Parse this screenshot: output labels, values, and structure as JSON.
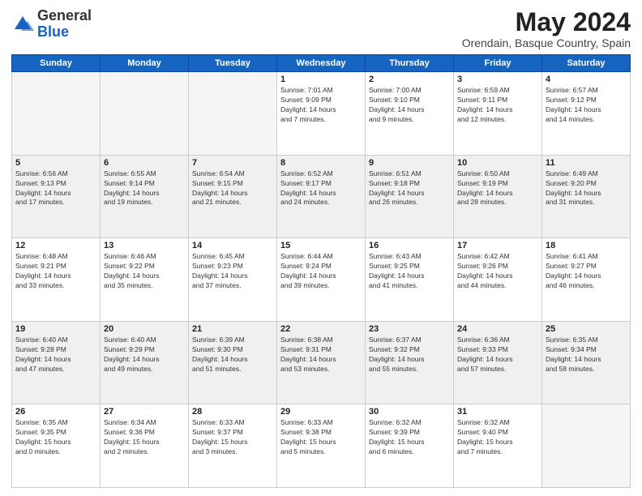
{
  "header": {
    "logo_general": "General",
    "logo_blue": "Blue",
    "month_title": "May 2024",
    "location": "Orendain, Basque Country, Spain"
  },
  "weekdays": [
    "Sunday",
    "Monday",
    "Tuesday",
    "Wednesday",
    "Thursday",
    "Friday",
    "Saturday"
  ],
  "weeks": [
    [
      {
        "day": "",
        "info": "",
        "empty": true
      },
      {
        "day": "",
        "info": "",
        "empty": true
      },
      {
        "day": "",
        "info": "",
        "empty": true
      },
      {
        "day": "1",
        "info": "Sunrise: 7:01 AM\nSunset: 9:09 PM\nDaylight: 14 hours\nand 7 minutes."
      },
      {
        "day": "2",
        "info": "Sunrise: 7:00 AM\nSunset: 9:10 PM\nDaylight: 14 hours\nand 9 minutes."
      },
      {
        "day": "3",
        "info": "Sunrise: 6:59 AM\nSunset: 9:11 PM\nDaylight: 14 hours\nand 12 minutes."
      },
      {
        "day": "4",
        "info": "Sunrise: 6:57 AM\nSunset: 9:12 PM\nDaylight: 14 hours\nand 14 minutes."
      }
    ],
    [
      {
        "day": "5",
        "info": "Sunrise: 6:56 AM\nSunset: 9:13 PM\nDaylight: 14 hours\nand 17 minutes."
      },
      {
        "day": "6",
        "info": "Sunrise: 6:55 AM\nSunset: 9:14 PM\nDaylight: 14 hours\nand 19 minutes."
      },
      {
        "day": "7",
        "info": "Sunrise: 6:54 AM\nSunset: 9:15 PM\nDaylight: 14 hours\nand 21 minutes."
      },
      {
        "day": "8",
        "info": "Sunrise: 6:52 AM\nSunset: 9:17 PM\nDaylight: 14 hours\nand 24 minutes."
      },
      {
        "day": "9",
        "info": "Sunrise: 6:51 AM\nSunset: 9:18 PM\nDaylight: 14 hours\nand 26 minutes."
      },
      {
        "day": "10",
        "info": "Sunrise: 6:50 AM\nSunset: 9:19 PM\nDaylight: 14 hours\nand 28 minutes."
      },
      {
        "day": "11",
        "info": "Sunrise: 6:49 AM\nSunset: 9:20 PM\nDaylight: 14 hours\nand 31 minutes."
      }
    ],
    [
      {
        "day": "12",
        "info": "Sunrise: 6:48 AM\nSunset: 9:21 PM\nDaylight: 14 hours\nand 33 minutes."
      },
      {
        "day": "13",
        "info": "Sunrise: 6:46 AM\nSunset: 9:22 PM\nDaylight: 14 hours\nand 35 minutes."
      },
      {
        "day": "14",
        "info": "Sunrise: 6:45 AM\nSunset: 9:23 PM\nDaylight: 14 hours\nand 37 minutes."
      },
      {
        "day": "15",
        "info": "Sunrise: 6:44 AM\nSunset: 9:24 PM\nDaylight: 14 hours\nand 39 minutes."
      },
      {
        "day": "16",
        "info": "Sunrise: 6:43 AM\nSunset: 9:25 PM\nDaylight: 14 hours\nand 41 minutes."
      },
      {
        "day": "17",
        "info": "Sunrise: 6:42 AM\nSunset: 9:26 PM\nDaylight: 14 hours\nand 44 minutes."
      },
      {
        "day": "18",
        "info": "Sunrise: 6:41 AM\nSunset: 9:27 PM\nDaylight: 14 hours\nand 46 minutes."
      }
    ],
    [
      {
        "day": "19",
        "info": "Sunrise: 6:40 AM\nSunset: 9:28 PM\nDaylight: 14 hours\nand 47 minutes."
      },
      {
        "day": "20",
        "info": "Sunrise: 6:40 AM\nSunset: 9:29 PM\nDaylight: 14 hours\nand 49 minutes."
      },
      {
        "day": "21",
        "info": "Sunrise: 6:39 AM\nSunset: 9:30 PM\nDaylight: 14 hours\nand 51 minutes."
      },
      {
        "day": "22",
        "info": "Sunrise: 6:38 AM\nSunset: 9:31 PM\nDaylight: 14 hours\nand 53 minutes."
      },
      {
        "day": "23",
        "info": "Sunrise: 6:37 AM\nSunset: 9:32 PM\nDaylight: 14 hours\nand 55 minutes."
      },
      {
        "day": "24",
        "info": "Sunrise: 6:36 AM\nSunset: 9:33 PM\nDaylight: 14 hours\nand 57 minutes."
      },
      {
        "day": "25",
        "info": "Sunrise: 6:35 AM\nSunset: 9:34 PM\nDaylight: 14 hours\nand 58 minutes."
      }
    ],
    [
      {
        "day": "26",
        "info": "Sunrise: 6:35 AM\nSunset: 9:35 PM\nDaylight: 15 hours\nand 0 minutes."
      },
      {
        "day": "27",
        "info": "Sunrise: 6:34 AM\nSunset: 9:36 PM\nDaylight: 15 hours\nand 2 minutes."
      },
      {
        "day": "28",
        "info": "Sunrise: 6:33 AM\nSunset: 9:37 PM\nDaylight: 15 hours\nand 3 minutes."
      },
      {
        "day": "29",
        "info": "Sunrise: 6:33 AM\nSunset: 9:38 PM\nDaylight: 15 hours\nand 5 minutes."
      },
      {
        "day": "30",
        "info": "Sunrise: 6:32 AM\nSunset: 9:39 PM\nDaylight: 15 hours\nand 6 minutes."
      },
      {
        "day": "31",
        "info": "Sunrise: 6:32 AM\nSunset: 9:40 PM\nDaylight: 15 hours\nand 7 minutes."
      },
      {
        "day": "",
        "info": "",
        "empty": true
      }
    ]
  ]
}
